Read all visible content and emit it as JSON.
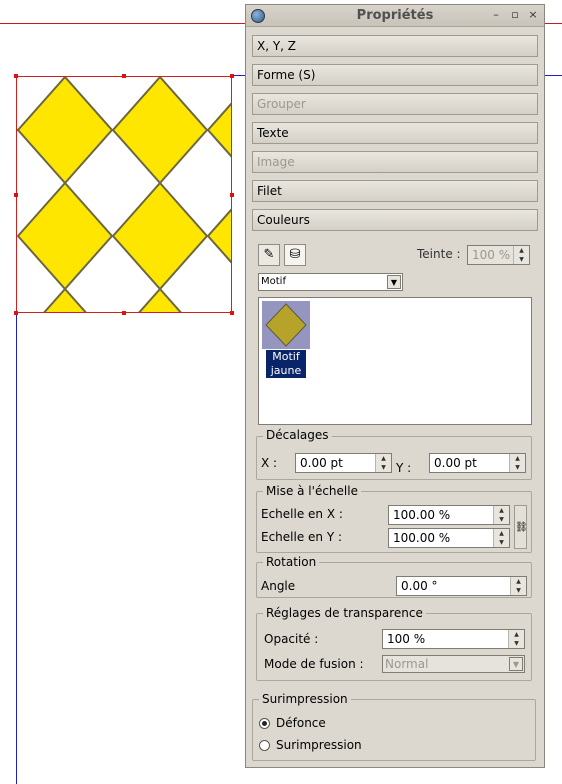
{
  "panel": {
    "title": "Propriétés",
    "window_buttons": [
      "–",
      "▫",
      "×"
    ],
    "sections": [
      {
        "label": "X, Y, Z",
        "enabled": true
      },
      {
        "label": "Forme (S)",
        "enabled": true
      },
      {
        "label": "Grouper",
        "enabled": false
      },
      {
        "label": "Texte",
        "enabled": true
      },
      {
        "label": "Image",
        "enabled": false
      },
      {
        "label": "Filet",
        "enabled": true
      },
      {
        "label": "Couleurs",
        "enabled": true
      }
    ],
    "colors": {
      "tint_label": "Teinte :",
      "tint_value": "100 %",
      "fill_type": "Motif",
      "pattern_name_line1": "Motif",
      "pattern_name_line2": "jaune"
    },
    "offsets": {
      "title": "Décalages",
      "x_label": "X :",
      "x_value": "0.00 pt",
      "y_label": "Y :",
      "y_value": "0.00 pt"
    },
    "scaling": {
      "title": "Mise à l'échelle",
      "x_label": "Echelle en X :",
      "x_value": "100.00 %",
      "y_label": "Echelle en Y :",
      "y_value": "100.00 %"
    },
    "rotation": {
      "title": "Rotation",
      "angle_label": "Angle",
      "angle_value": "0.00 °"
    },
    "transparency": {
      "title": "Réglages de transparence",
      "opacity_label": "Opacité :",
      "opacity_value": "100 %",
      "blend_label": "Mode de fusion :",
      "blend_value": "Normal"
    },
    "overprint": {
      "title": "Surimpression",
      "options": [
        "Défonce",
        "Surimpression"
      ],
      "selected": "Défonce"
    }
  },
  "theme": {
    "diamond_yellow": "#ffe600",
    "diamond_olive": "#b5a32a",
    "selection_blue": "#0a246a",
    "guide_blue": "#2020c0",
    "margin_red": "#d01818"
  }
}
